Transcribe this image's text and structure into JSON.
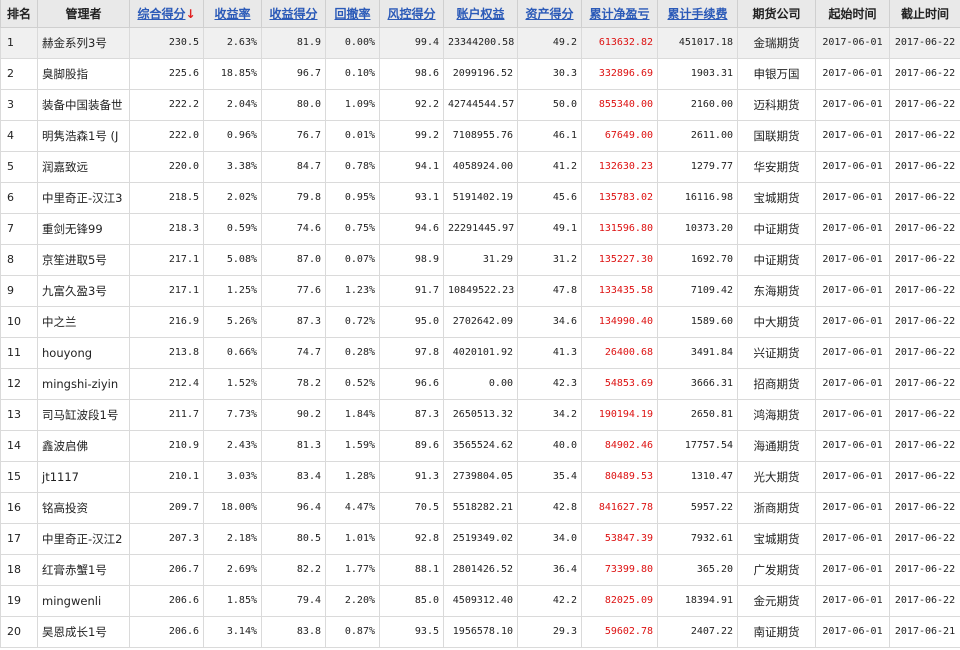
{
  "columns": {
    "rank": "排名",
    "manager": "管理者",
    "total_score": "综合得分",
    "total_score_sort": "↓",
    "return_rate": "收益率",
    "return_score": "收益得分",
    "drawdown": "回撤率",
    "risk_score": "风控得分",
    "equity": "账户权益",
    "asset_score": "资产得分",
    "net_profit": "累计净盈亏",
    "fees": "累计手续费",
    "broker": "期货公司",
    "start": "起始时间",
    "end": "截止时间"
  },
  "colors": {
    "profit": "#dd1111",
    "link": "#2b5ab8",
    "header_bg": "#e9e9e9"
  },
  "rows": [
    {
      "rank": "1",
      "manager": "赫金系列3号",
      "total_score": "230.5",
      "return_rate": "2.63%",
      "return_score": "81.9",
      "drawdown": "0.00%",
      "risk_score": "99.4",
      "equity": "23344200.58",
      "asset_score": "49.2",
      "net_profit": "613632.82",
      "fees": "451017.18",
      "broker": "金瑞期货",
      "start": "2017-06-01",
      "end": "2017-06-22"
    },
    {
      "rank": "2",
      "manager": "臭脚股指",
      "total_score": "225.6",
      "return_rate": "18.85%",
      "return_score": "96.7",
      "drawdown": "0.10%",
      "risk_score": "98.6",
      "equity": "2099196.52",
      "asset_score": "30.3",
      "net_profit": "332896.69",
      "fees": "1903.31",
      "broker": "申银万国",
      "start": "2017-06-01",
      "end": "2017-06-22"
    },
    {
      "rank": "3",
      "manager": "装备中国装备世",
      "total_score": "222.2",
      "return_rate": "2.04%",
      "return_score": "80.0",
      "drawdown": "1.09%",
      "risk_score": "92.2",
      "equity": "42744544.57",
      "asset_score": "50.0",
      "net_profit": "855340.00",
      "fees": "2160.00",
      "broker": "迈科期货",
      "start": "2017-06-01",
      "end": "2017-06-22"
    },
    {
      "rank": "4",
      "manager": "明隽浩森1号 (J",
      "total_score": "222.0",
      "return_rate": "0.96%",
      "return_score": "76.7",
      "drawdown": "0.01%",
      "risk_score": "99.2",
      "equity": "7108955.76",
      "asset_score": "46.1",
      "net_profit": "67649.00",
      "fees": "2611.00",
      "broker": "国联期货",
      "start": "2017-06-01",
      "end": "2017-06-22"
    },
    {
      "rank": "5",
      "manager": "润嘉致远",
      "total_score": "220.0",
      "return_rate": "3.38%",
      "return_score": "84.7",
      "drawdown": "0.78%",
      "risk_score": "94.1",
      "equity": "4058924.00",
      "asset_score": "41.2",
      "net_profit": "132630.23",
      "fees": "1279.77",
      "broker": "华安期货",
      "start": "2017-06-01",
      "end": "2017-06-22"
    },
    {
      "rank": "6",
      "manager": "中里奇正-汉江3",
      "total_score": "218.5",
      "return_rate": "2.02%",
      "return_score": "79.8",
      "drawdown": "0.95%",
      "risk_score": "93.1",
      "equity": "5191402.19",
      "asset_score": "45.6",
      "net_profit": "135783.02",
      "fees": "16116.98",
      "broker": "宝城期货",
      "start": "2017-06-01",
      "end": "2017-06-22"
    },
    {
      "rank": "7",
      "manager": "重剑无锋99",
      "total_score": "218.3",
      "return_rate": "0.59%",
      "return_score": "74.6",
      "drawdown": "0.75%",
      "risk_score": "94.6",
      "equity": "22291445.97",
      "asset_score": "49.1",
      "net_profit": "131596.80",
      "fees": "10373.20",
      "broker": "中证期货",
      "start": "2017-06-01",
      "end": "2017-06-22"
    },
    {
      "rank": "8",
      "manager": "京笙进取5号",
      "total_score": "217.1",
      "return_rate": "5.08%",
      "return_score": "87.0",
      "drawdown": "0.07%",
      "risk_score": "98.9",
      "equity": "31.29",
      "asset_score": "31.2",
      "net_profit": "135227.30",
      "fees": "1692.70",
      "broker": "中证期货",
      "start": "2017-06-01",
      "end": "2017-06-22"
    },
    {
      "rank": "9",
      "manager": "九富久盈3号",
      "total_score": "217.1",
      "return_rate": "1.25%",
      "return_score": "77.6",
      "drawdown": "1.23%",
      "risk_score": "91.7",
      "equity": "10849522.23",
      "asset_score": "47.8",
      "net_profit": "133435.58",
      "fees": "7109.42",
      "broker": "东海期货",
      "start": "2017-06-01",
      "end": "2017-06-22"
    },
    {
      "rank": "10",
      "manager": "中之兰",
      "total_score": "216.9",
      "return_rate": "5.26%",
      "return_score": "87.3",
      "drawdown": "0.72%",
      "risk_score": "95.0",
      "equity": "2702642.09",
      "asset_score": "34.6",
      "net_profit": "134990.40",
      "fees": "1589.60",
      "broker": "中大期货",
      "start": "2017-06-01",
      "end": "2017-06-22"
    },
    {
      "rank": "11",
      "manager": "houyong",
      "total_score": "213.8",
      "return_rate": "0.66%",
      "return_score": "74.7",
      "drawdown": "0.28%",
      "risk_score": "97.8",
      "equity": "4020101.92",
      "asset_score": "41.3",
      "net_profit": "26400.68",
      "fees": "3491.84",
      "broker": "兴证期货",
      "start": "2017-06-01",
      "end": "2017-06-22"
    },
    {
      "rank": "12",
      "manager": "mingshi-ziyin",
      "total_score": "212.4",
      "return_rate": "1.52%",
      "return_score": "78.2",
      "drawdown": "0.52%",
      "risk_score": "96.6",
      "equity": "0.00",
      "asset_score": "42.3",
      "net_profit": "54853.69",
      "fees": "3666.31",
      "broker": "招商期货",
      "start": "2017-06-01",
      "end": "2017-06-22"
    },
    {
      "rank": "13",
      "manager": "司马缸波段1号",
      "total_score": "211.7",
      "return_rate": "7.73%",
      "return_score": "90.2",
      "drawdown": "1.84%",
      "risk_score": "87.3",
      "equity": "2650513.32",
      "asset_score": "34.2",
      "net_profit": "190194.19",
      "fees": "2650.81",
      "broker": "鸿海期货",
      "start": "2017-06-01",
      "end": "2017-06-22"
    },
    {
      "rank": "14",
      "manager": "鑫波启佛",
      "total_score": "210.9",
      "return_rate": "2.43%",
      "return_score": "81.3",
      "drawdown": "1.59%",
      "risk_score": "89.6",
      "equity": "3565524.62",
      "asset_score": "40.0",
      "net_profit": "84902.46",
      "fees": "17757.54",
      "broker": "海通期货",
      "start": "2017-06-01",
      "end": "2017-06-22"
    },
    {
      "rank": "15",
      "manager": "jt1117",
      "total_score": "210.1",
      "return_rate": "3.03%",
      "return_score": "83.4",
      "drawdown": "1.28%",
      "risk_score": "91.3",
      "equity": "2739804.05",
      "asset_score": "35.4",
      "net_profit": "80489.53",
      "fees": "1310.47",
      "broker": "光大期货",
      "start": "2017-06-01",
      "end": "2017-06-22"
    },
    {
      "rank": "16",
      "manager": "铭高投资",
      "total_score": "209.7",
      "return_rate": "18.00%",
      "return_score": "96.4",
      "drawdown": "4.47%",
      "risk_score": "70.5",
      "equity": "5518282.21",
      "asset_score": "42.8",
      "net_profit": "841627.78",
      "fees": "5957.22",
      "broker": "浙商期货",
      "start": "2017-06-01",
      "end": "2017-06-22"
    },
    {
      "rank": "17",
      "manager": "中里奇正-汉江2",
      "total_score": "207.3",
      "return_rate": "2.18%",
      "return_score": "80.5",
      "drawdown": "1.01%",
      "risk_score": "92.8",
      "equity": "2519349.02",
      "asset_score": "34.0",
      "net_profit": "53847.39",
      "fees": "7932.61",
      "broker": "宝城期货",
      "start": "2017-06-01",
      "end": "2017-06-22"
    },
    {
      "rank": "18",
      "manager": "红膏赤蟹1号",
      "total_score": "206.7",
      "return_rate": "2.69%",
      "return_score": "82.2",
      "drawdown": "1.77%",
      "risk_score": "88.1",
      "equity": "2801426.52",
      "asset_score": "36.4",
      "net_profit": "73399.80",
      "fees": "365.20",
      "broker": "广发期货",
      "start": "2017-06-01",
      "end": "2017-06-22"
    },
    {
      "rank": "19",
      "manager": "mingwenli",
      "total_score": "206.6",
      "return_rate": "1.85%",
      "return_score": "79.4",
      "drawdown": "2.20%",
      "risk_score": "85.0",
      "equity": "4509312.40",
      "asset_score": "42.2",
      "net_profit": "82025.09",
      "fees": "18394.91",
      "broker": "金元期货",
      "start": "2017-06-01",
      "end": "2017-06-22"
    },
    {
      "rank": "20",
      "manager": "昊恩成长1号",
      "total_score": "206.6",
      "return_rate": "3.14%",
      "return_score": "83.8",
      "drawdown": "0.87%",
      "risk_score": "93.5",
      "equity": "1956578.10",
      "asset_score": "29.3",
      "net_profit": "59602.78",
      "fees": "2407.22",
      "broker": "南证期货",
      "start": "2017-06-01",
      "end": "2017-06-21"
    }
  ]
}
